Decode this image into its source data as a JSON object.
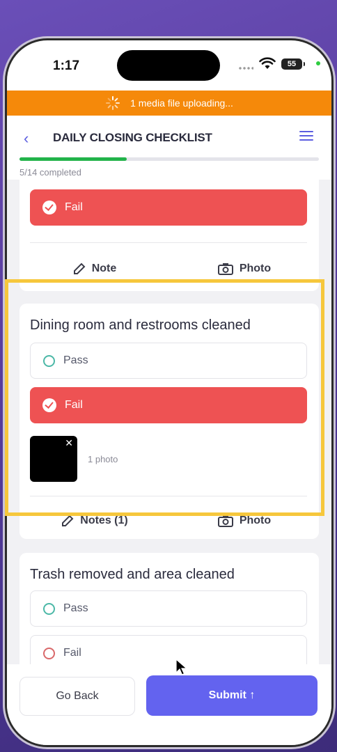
{
  "status_bar": {
    "time": "1:17",
    "battery": "55"
  },
  "upload_banner": {
    "text": "1 media file uploading..."
  },
  "header": {
    "title": "DAILY CLOSING CHECKLIST"
  },
  "progress": {
    "completed": 5,
    "total": 14,
    "text": "5/14 completed"
  },
  "items": [
    {
      "selected_label": "Fail",
      "note_label": "Note",
      "photo_label": "Photo"
    },
    {
      "question": "Dining room and restrooms cleaned",
      "pass_label": "Pass",
      "fail_label": "Fail",
      "selected": "Fail",
      "photo_count_text": "1 photo",
      "notes_label": "Notes (1)",
      "photo_label": "Photo"
    },
    {
      "question": "Trash removed and area cleaned",
      "pass_label": "Pass",
      "fail_label": "Fail"
    }
  ],
  "footer": {
    "back_label": "Go Back",
    "submit_label": "Submit ↑"
  },
  "colors": {
    "accent": "#6363ef",
    "fail": "#ee5253",
    "banner": "#f5890a",
    "progress": "#22b34a",
    "highlight": "#f6c73c"
  }
}
